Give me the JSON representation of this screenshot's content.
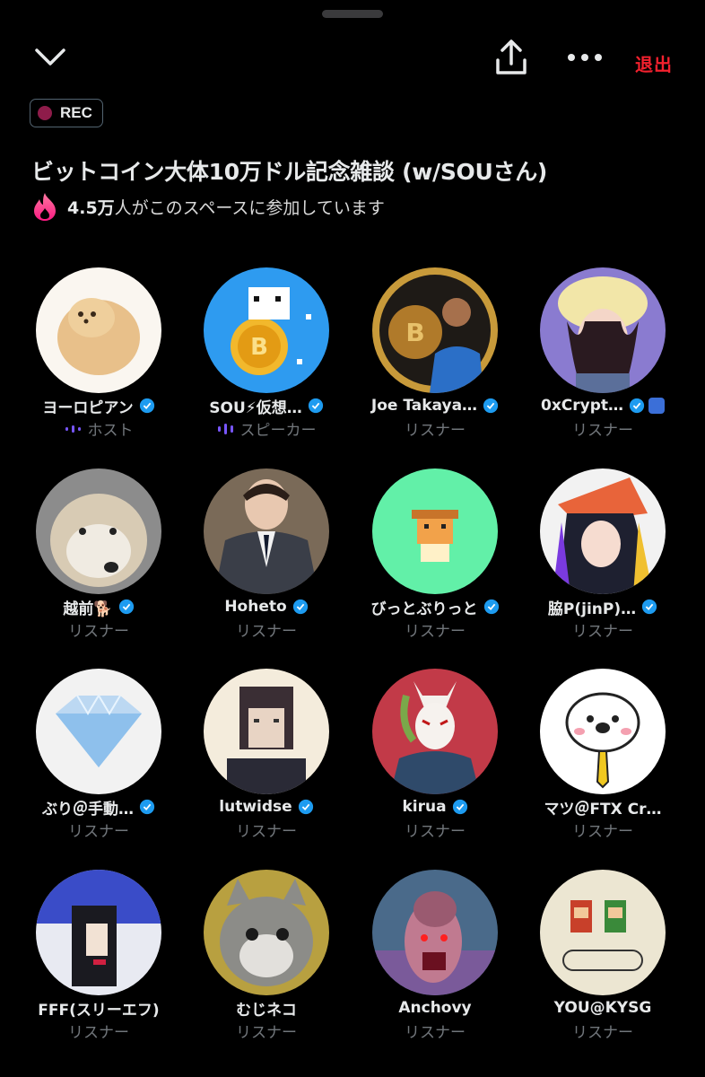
{
  "header": {
    "leave_label": "退出",
    "rec_label": "REC",
    "title": "ビットコイン大体10万ドル記念雑談 (w/SOUさん)",
    "listener_count": "4.5万",
    "listener_suffix": "人がこのスペースに参加しています"
  },
  "colors": {
    "accent_red": "#f4212e",
    "verified_blue": "#1d9bf0",
    "speaker_purple": "#7856ff",
    "secondary_text": "#71767b"
  },
  "participants": [
    {
      "name": "ヨーロピアン",
      "role": "ホスト",
      "verified": true,
      "speaking_icon": "audio-wave-icon"
    },
    {
      "name": "SOU⚡仮想…",
      "role": "スピーカー",
      "verified": true,
      "speaking_icon": "audio-wave-icon"
    },
    {
      "name": "Joe Takaya…",
      "role": "リスナー",
      "verified": true
    },
    {
      "name": "0xCrypt…",
      "role": "リスナー",
      "verified": true,
      "extra_badge": "org-badge-icon"
    },
    {
      "name": "越前🐕",
      "role": "リスナー",
      "verified": true
    },
    {
      "name": "Hoheto",
      "role": "リスナー",
      "verified": true
    },
    {
      "name": "びっとぶりっと",
      "role": "リスナー",
      "verified": true
    },
    {
      "name": "脇P(jinP)…",
      "role": "リスナー",
      "verified": true
    },
    {
      "name": "ぶり＠手動…",
      "role": "リスナー",
      "verified": true
    },
    {
      "name": "lutwidse",
      "role": "リスナー",
      "verified": true
    },
    {
      "name": "kirua",
      "role": "リスナー",
      "verified": true
    },
    {
      "name": "マツ＠FTX Cr…",
      "role": "リスナー",
      "verified": false
    },
    {
      "name": "FFF(スリーエフ)",
      "role": "リスナー",
      "verified": false
    },
    {
      "name": "むじネコ",
      "role": "リスナー",
      "verified": false
    },
    {
      "name": "Anchovy",
      "role": "リスナー",
      "verified": false
    },
    {
      "name": "YOU@KYSG",
      "role": "リスナー",
      "verified": false
    }
  ]
}
